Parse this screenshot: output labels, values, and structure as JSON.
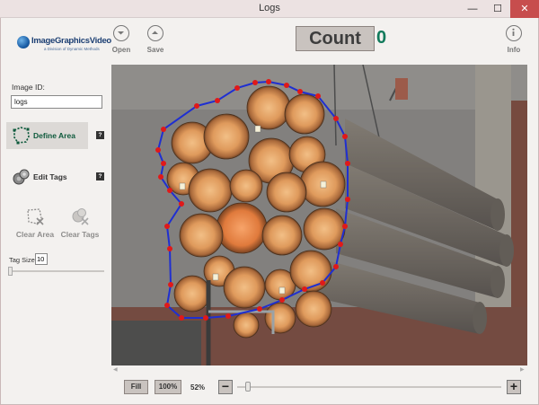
{
  "window": {
    "title": "Logs",
    "minimize": "—",
    "maximize": "☐",
    "close": "✕"
  },
  "header": {
    "logo_text": "ImageGraphicsVideo",
    "logo_sub": "a Division of Dynamic Methods",
    "open_label": "Open",
    "save_label": "Save",
    "info_label": "Info",
    "count_label": "Count",
    "count_value": "0"
  },
  "sidebar": {
    "image_id_label": "Image ID:",
    "image_id_value": "logs",
    "define_area_label": "Define Area",
    "edit_tags_label": "Edit Tags",
    "help_glyph": "?",
    "clear_area_label": "Clear Area",
    "clear_tags_label": "Clear Tags",
    "tag_size_label": "Tag Size",
    "tag_size_value": "10"
  },
  "zoombar": {
    "fill_label": "Fill",
    "hundred_label": "100%",
    "zoom_value": "52%",
    "minus_glyph": "−",
    "plus_glyph": "+",
    "zoom_slider_fraction": 0.05
  },
  "scroll": {
    "left": "◀",
    "right": "▶"
  },
  "colors": {
    "accent_green": "#117a5b",
    "polygon_stroke": "#1f2fd1",
    "vertex": "#e01919",
    "close_red": "#c74d4d"
  }
}
